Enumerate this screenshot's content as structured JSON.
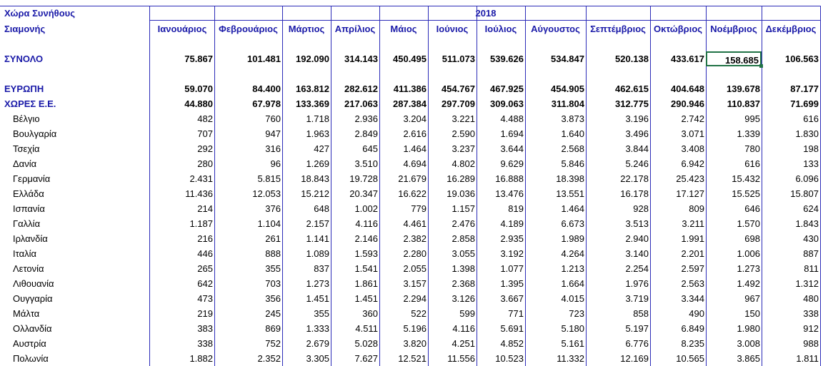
{
  "header": {
    "col_label_line1": "Χώρα Συνήθους",
    "col_label_line2": "Σιαμονής",
    "year": "2018",
    "months": [
      "Ιανουάριος",
      "Φεβρουάριος",
      "Μάρτιος",
      "Απρίλιος",
      "Μάιος",
      "Ιούνιος",
      "Ιούλιος",
      "Αύγουστος",
      "Σεπτέμβριος",
      "Οκτώβριος",
      "Νοέμβριος",
      "Δεκέμβριος"
    ]
  },
  "selected_cell": {
    "row": 0,
    "col": 10
  },
  "rows": [
    {
      "label": "ΣΥΝΟΛΟ",
      "style": "total",
      "values": [
        "75.867",
        "101.481",
        "192.090",
        "314.143",
        "450.495",
        "511.073",
        "539.626",
        "534.847",
        "520.138",
        "433.617",
        "158.685",
        "106.563"
      ]
    },
    {
      "label": "ΕΥΡΩΠΗ",
      "style": "total",
      "values": [
        "59.070",
        "84.400",
        "163.812",
        "282.612",
        "411.386",
        "454.767",
        "467.925",
        "454.905",
        "462.615",
        "404.648",
        "139.678",
        "87.177"
      ]
    },
    {
      "label": "ΧΩΡΕΣ Ε.Ε.",
      "style": "total",
      "values": [
        "44.880",
        "67.978",
        "133.369",
        "217.063",
        "287.384",
        "297.709",
        "309.063",
        "311.804",
        "312.775",
        "290.946",
        "110.837",
        "71.699"
      ]
    },
    {
      "label": "Βέλγιο",
      "style": "country",
      "values": [
        "482",
        "760",
        "1.718",
        "2.936",
        "3.204",
        "3.221",
        "4.488",
        "3.873",
        "3.196",
        "2.742",
        "995",
        "616"
      ]
    },
    {
      "label": "Βουλγαρία",
      "style": "country",
      "values": [
        "707",
        "947",
        "1.963",
        "2.849",
        "2.616",
        "2.590",
        "1.694",
        "1.640",
        "3.496",
        "3.071",
        "1.339",
        "1.830"
      ]
    },
    {
      "label": "Τσεχία",
      "style": "country",
      "values": [
        "292",
        "316",
        "427",
        "645",
        "1.464",
        "3.237",
        "3.644",
        "2.568",
        "3.844",
        "3.408",
        "780",
        "198"
      ]
    },
    {
      "label": "Δανία",
      "style": "country",
      "values": [
        "280",
        "96",
        "1.269",
        "3.510",
        "4.694",
        "4.802",
        "9.629",
        "5.846",
        "5.246",
        "6.942",
        "616",
        "133"
      ]
    },
    {
      "label": "Γερμανία",
      "style": "country",
      "values": [
        "2.431",
        "5.815",
        "18.843",
        "19.728",
        "21.679",
        "16.289",
        "16.888",
        "18.398",
        "22.178",
        "25.423",
        "15.432",
        "6.096"
      ]
    },
    {
      "label": "Ελλάδα",
      "style": "country",
      "values": [
        "11.436",
        "12.053",
        "15.212",
        "20.347",
        "16.622",
        "19.036",
        "13.476",
        "13.551",
        "16.178",
        "17.127",
        "15.525",
        "15.807"
      ]
    },
    {
      "label": "Ισπανία",
      "style": "country",
      "values": [
        "214",
        "376",
        "648",
        "1.002",
        "779",
        "1.157",
        "819",
        "1.464",
        "928",
        "809",
        "646",
        "624"
      ]
    },
    {
      "label": "Γαλλία",
      "style": "country",
      "values": [
        "1.187",
        "1.104",
        "2.157",
        "4.116",
        "4.461",
        "2.476",
        "4.189",
        "6.673",
        "3.513",
        "3.211",
        "1.570",
        "1.843"
      ]
    },
    {
      "label": "Ιρλανδία",
      "style": "country",
      "values": [
        "216",
        "261",
        "1.141",
        "2.146",
        "2.382",
        "2.858",
        "2.935",
        "1.989",
        "2.940",
        "1.991",
        "698",
        "430"
      ]
    },
    {
      "label": "Ιταλία",
      "style": "country",
      "values": [
        "446",
        "888",
        "1.089",
        "1.593",
        "2.280",
        "3.055",
        "3.192",
        "4.264",
        "3.140",
        "2.201",
        "1.006",
        "887"
      ]
    },
    {
      "label": "Λετονία",
      "style": "country",
      "values": [
        "265",
        "355",
        "837",
        "1.541",
        "2.055",
        "1.398",
        "1.077",
        "1.213",
        "2.254",
        "2.597",
        "1.273",
        "811"
      ]
    },
    {
      "label": "Λιθουανία",
      "style": "country",
      "values": [
        "642",
        "703",
        "1.273",
        "1.861",
        "3.157",
        "2.368",
        "1.395",
        "1.664",
        "1.976",
        "2.563",
        "1.492",
        "1.312"
      ]
    },
    {
      "label": "Ουγγαρία",
      "style": "country",
      "values": [
        "473",
        "356",
        "1.451",
        "1.451",
        "2.294",
        "3.126",
        "3.667",
        "4.015",
        "3.719",
        "3.344",
        "967",
        "480"
      ]
    },
    {
      "label": "Μάλτα",
      "style": "country",
      "values": [
        "219",
        "245",
        "355",
        "360",
        "522",
        "599",
        "771",
        "723",
        "858",
        "490",
        "150",
        "338"
      ]
    },
    {
      "label": "Ολλανδία",
      "style": "country",
      "values": [
        "383",
        "869",
        "1.333",
        "4.511",
        "5.196",
        "4.116",
        "5.691",
        "5.180",
        "5.197",
        "6.849",
        "1.980",
        "912"
      ]
    },
    {
      "label": "Αυστρία",
      "style": "country",
      "values": [
        "338",
        "752",
        "2.679",
        "5.028",
        "3.820",
        "4.251",
        "4.852",
        "5.161",
        "6.776",
        "8.235",
        "3.008",
        "988"
      ]
    },
    {
      "label": "Πολωνία",
      "style": "country",
      "values": [
        "1.882",
        "2.352",
        "3.305",
        "7.627",
        "12.521",
        "11.556",
        "10.523",
        "11.332",
        "12.169",
        "10.565",
        "3.865",
        "1.811"
      ]
    }
  ]
}
